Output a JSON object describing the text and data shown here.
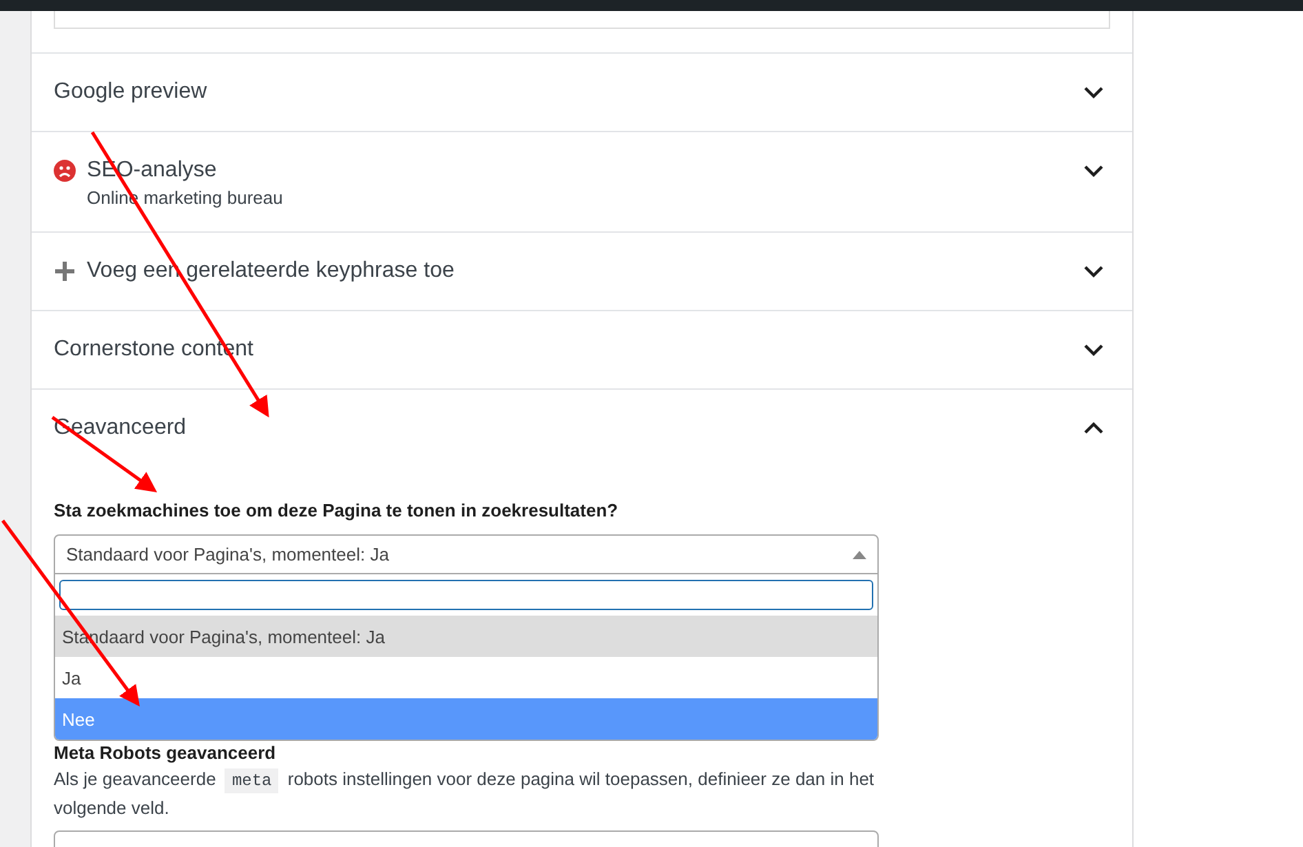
{
  "sections": [
    {
      "title": "Google preview",
      "kind": "plain",
      "expanded": false
    },
    {
      "title": "SEO-analyse",
      "subtitle": "Online marketing bureau",
      "kind": "analysis",
      "expanded": false
    },
    {
      "title": "Voeg een gerelateerde keyphrase toe",
      "kind": "add",
      "expanded": false
    },
    {
      "title": "Cornerstone content",
      "kind": "plain",
      "expanded": false
    },
    {
      "title": "Geavanceerd",
      "kind": "plain",
      "expanded": true
    }
  ],
  "advanced": {
    "question": "Sta zoekmachines toe om deze Pagina te tonen in zoekresultaten?",
    "select_value": "Standaard voor Pagina's, momenteel: Ja",
    "options": [
      {
        "label": "Standaard voor Pagina's, momenteel: Ja",
        "selected": false,
        "current": true
      },
      {
        "label": "Ja",
        "selected": false,
        "current": false
      },
      {
        "label": "Nee",
        "selected": true,
        "current": false
      }
    ],
    "meta_title": "Meta Robots geavanceerd",
    "meta_text_before": "Als je geavanceerde",
    "meta_code": "meta",
    "meta_text_after": "robots instellingen voor deze pagina wil toepassen, definieer ze dan in het volgende veld."
  }
}
